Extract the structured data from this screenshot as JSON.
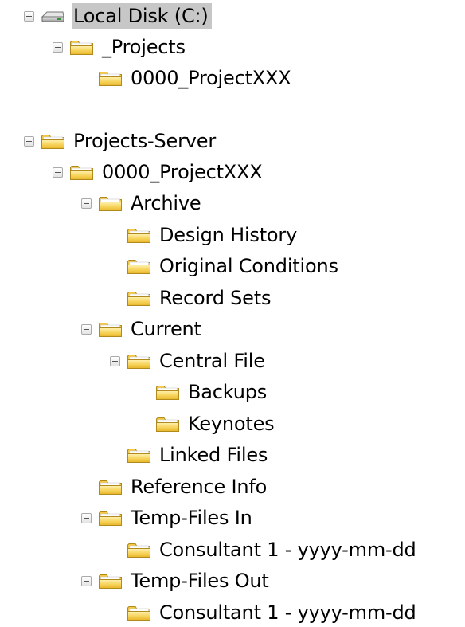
{
  "tree": [
    {
      "id": "local-disk",
      "label": "Local Disk (C:)",
      "depth": 0,
      "expanded": true,
      "icon": "drive-icon",
      "selected": true
    },
    {
      "id": "projects",
      "label": "_Projects",
      "depth": 1,
      "expanded": true,
      "icon": "folder-icon"
    },
    {
      "id": "projects-0000",
      "label": "0000_ProjectXXX",
      "depth": 2,
      "expanded": null,
      "icon": "folder-icon"
    },
    {
      "id": "projects-server",
      "label": "Projects-Server",
      "depth": 0,
      "expanded": true,
      "icon": "folder-icon"
    },
    {
      "id": "server-0000",
      "label": "0000_ProjectXXX",
      "depth": 1,
      "expanded": true,
      "icon": "folder-icon"
    },
    {
      "id": "archive",
      "label": "Archive",
      "depth": 2,
      "expanded": true,
      "icon": "folder-icon"
    },
    {
      "id": "design-history",
      "label": "Design History",
      "depth": 3,
      "expanded": null,
      "icon": "folder-icon"
    },
    {
      "id": "original-conditions",
      "label": "Original Conditions",
      "depth": 3,
      "expanded": null,
      "icon": "folder-icon"
    },
    {
      "id": "record-sets",
      "label": "Record Sets",
      "depth": 3,
      "expanded": null,
      "icon": "folder-icon"
    },
    {
      "id": "current",
      "label": "Current",
      "depth": 2,
      "expanded": true,
      "icon": "folder-icon"
    },
    {
      "id": "central-file",
      "label": "Central File",
      "depth": 3,
      "expanded": true,
      "icon": "folder-icon"
    },
    {
      "id": "backups",
      "label": "Backups",
      "depth": 4,
      "expanded": null,
      "icon": "folder-icon"
    },
    {
      "id": "keynotes",
      "label": "Keynotes",
      "depth": 4,
      "expanded": null,
      "icon": "folder-icon"
    },
    {
      "id": "linked-files",
      "label": "Linked Files",
      "depth": 3,
      "expanded": null,
      "icon": "folder-icon"
    },
    {
      "id": "reference-info",
      "label": "Reference Info",
      "depth": 2,
      "expanded": null,
      "icon": "folder-icon"
    },
    {
      "id": "temp-files-in",
      "label": "Temp-Files In",
      "depth": 2,
      "expanded": true,
      "icon": "folder-icon"
    },
    {
      "id": "temp-in-consultant-1",
      "label": "Consultant 1 - yyyy-mm-dd",
      "depth": 3,
      "expanded": null,
      "icon": "folder-icon"
    },
    {
      "id": "temp-files-out",
      "label": "Temp-Files Out",
      "depth": 2,
      "expanded": true,
      "icon": "folder-icon"
    },
    {
      "id": "temp-out-consultant-1",
      "label": "Consultant 1 - yyyy-mm-dd",
      "depth": 3,
      "expanded": null,
      "icon": "folder-icon"
    }
  ],
  "colors": {
    "selection": "#c7c7c7",
    "folder_fill": "#f5c842",
    "folder_outline": "#b08a1c"
  }
}
